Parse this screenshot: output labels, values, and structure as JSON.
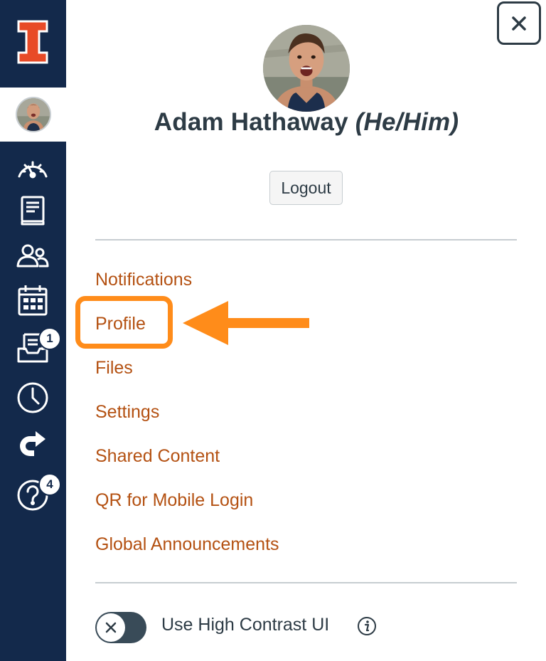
{
  "global_nav": {
    "items": [
      {
        "name": "dashboard",
        "icon": "dashboard-icon"
      },
      {
        "name": "courses",
        "icon": "courses-icon"
      },
      {
        "name": "groups",
        "icon": "groups-icon"
      },
      {
        "name": "calendar",
        "icon": "calendar-icon"
      },
      {
        "name": "inbox",
        "icon": "inbox-icon",
        "badge": "1"
      },
      {
        "name": "history",
        "icon": "history-icon"
      },
      {
        "name": "commons",
        "icon": "commons-icon"
      },
      {
        "name": "help",
        "icon": "help-icon",
        "badge": "4"
      }
    ]
  },
  "tray": {
    "user": {
      "name": "Adam Hathaway",
      "pronouns": "(He/Him)"
    },
    "logout_label": "Logout",
    "menu_items": [
      "Notifications",
      "Profile",
      "Files",
      "Settings",
      "Shared Content",
      "QR for Mobile Login",
      "Global Announcements"
    ],
    "high_contrast_label": "Use High Contrast UI",
    "high_contrast_enabled": false
  },
  "colors": {
    "nav_background": "#13294b",
    "brand_orange": "#e84a27",
    "link": "#b45112",
    "highlight": "#ff8c1a",
    "text": "#2d3b45"
  }
}
